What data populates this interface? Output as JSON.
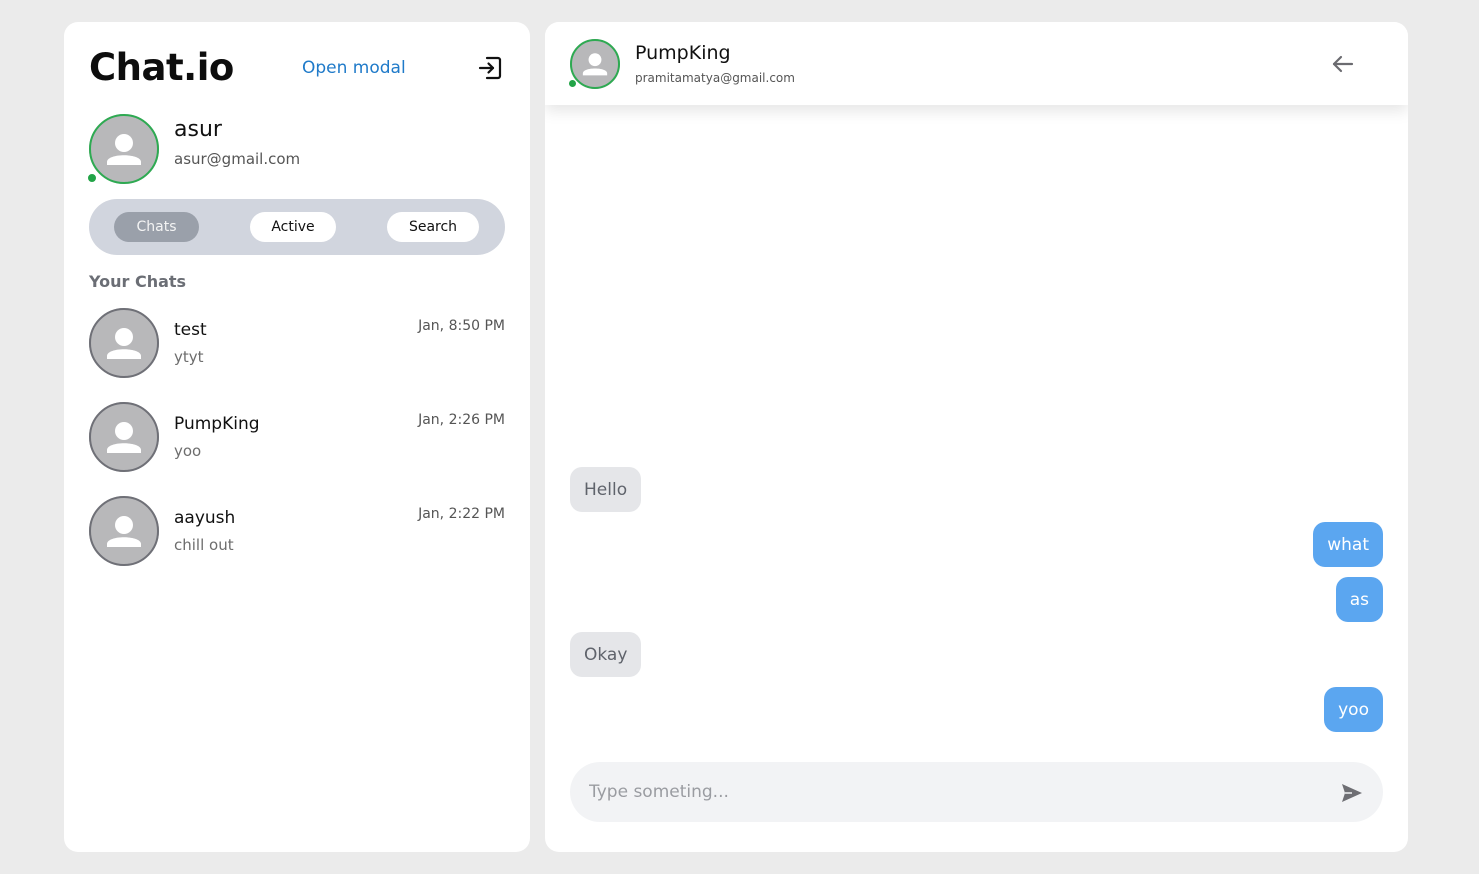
{
  "app": {
    "title": "Chat.io",
    "open_modal_label": "Open modal",
    "logout_icon": "logout-icon"
  },
  "me": {
    "name": "asur",
    "email": "asur@gmail.com",
    "status": "online"
  },
  "tabs": [
    {
      "label": "Chats",
      "active": true
    },
    {
      "label": "Active",
      "active": false
    },
    {
      "label": "Search",
      "active": false
    }
  ],
  "chats_section_title": "Your Chats",
  "chats": [
    {
      "name": "test",
      "last_message": "ytyt",
      "time": "Jan, 8:50 PM"
    },
    {
      "name": "PumpKing",
      "last_message": "yoo",
      "time": "Jan, 2:26 PM"
    },
    {
      "name": "aayush",
      "last_message": "chill out",
      "time": "Jan, 2:22 PM"
    }
  ],
  "conversation": {
    "peer_name": "PumpKing",
    "peer_email": "pramitamatya@gmail.com",
    "peer_status": "online",
    "back_icon": "arrow-left-icon",
    "messages": [
      {
        "text": "Hello",
        "direction": "in"
      },
      {
        "text": "what",
        "direction": "out"
      },
      {
        "text": "as",
        "direction": "out"
      },
      {
        "text": "Okay",
        "direction": "in"
      },
      {
        "text": "yoo",
        "direction": "out"
      }
    ],
    "input_placeholder": "Type someting...",
    "input_value": "",
    "send_icon": "send-icon"
  },
  "colors": {
    "background": "#ebebeb",
    "accent_link": "#1f7ac9",
    "online": "#22a447",
    "outgoing_bubble": "#5ba6f0",
    "incoming_bubble": "#e5e6e9",
    "tab_active": "#9aa0aa",
    "tab_track": "#d1d5de"
  }
}
